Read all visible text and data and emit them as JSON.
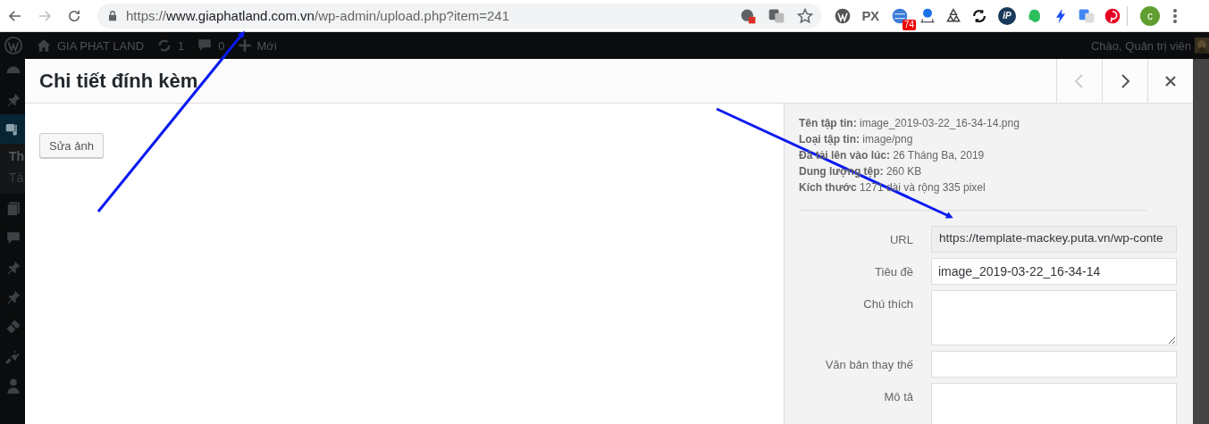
{
  "browser": {
    "back": {
      "disabled": false
    },
    "forward": {
      "disabled": true
    },
    "url": {
      "scheme": "https://",
      "host": "www.giaphatland.com.vn",
      "path": "/wp-admin/upload.php?item=241"
    },
    "omnibox_icons": [
      {
        "kind": "cookie-blocked"
      },
      {
        "kind": "translate"
      },
      {
        "kind": "star"
      }
    ],
    "extensions": [
      {
        "kind": "wordpress"
      },
      {
        "kind": "text",
        "label": "PX"
      },
      {
        "kind": "globe",
        "badge": "74"
      },
      {
        "kind": "scale"
      },
      {
        "kind": "recycle"
      },
      {
        "kind": "sync"
      },
      {
        "kind": "circle-text",
        "label": "iP"
      },
      {
        "kind": "elephant"
      },
      {
        "kind": "bolt"
      },
      {
        "kind": "translate"
      },
      {
        "kind": "pinterest"
      }
    ],
    "profile": {
      "initial": "c"
    }
  },
  "admin_bar": {
    "site": "GIA PHAT LAND",
    "updates": "1",
    "comments": "0",
    "new": "Mới",
    "greeting": "Chào, Quản trị viên"
  },
  "sidebar": {
    "items": [
      {
        "kind": "dashboard",
        "selected": false
      },
      {
        "kind": "pin",
        "selected": false
      },
      {
        "kind": "media",
        "selected": true,
        "children": [
          {
            "label": "Th",
            "selected": true
          },
          {
            "label": "Tà",
            "selected": false
          }
        ]
      },
      {
        "kind": "pages",
        "selected": false
      },
      {
        "kind": "comment",
        "selected": false
      },
      {
        "kind": "pin",
        "selected": false
      },
      {
        "kind": "pin",
        "selected": false
      },
      {
        "kind": "brush",
        "selected": false
      },
      {
        "kind": "plug",
        "selected": false
      },
      {
        "kind": "user",
        "selected": false
      }
    ]
  },
  "modal": {
    "title": "Chi tiết đính kèm",
    "prev": {
      "disabled": true
    },
    "next": {
      "disabled": false
    },
    "edit_button": "Sửa ảnh",
    "details": [
      "**Tên tập tin:** image_2019-03-22_16-34-14.png",
      "**Loại tập tin:** image/png",
      "**Đã tải lên vào lúc:** 26 Tháng Ba, 2019",
      "**Dung lượng tệp:** 260 KB",
      "**Kích thước** 1271 dài và rộng 335 pixel"
    ],
    "fields": [
      {
        "label": "URL",
        "kind": "readonly",
        "value": "https://template-mackey.puta.vn/wp-conte"
      },
      {
        "label": "Tiêu đề",
        "kind": "text",
        "value": "image_2019-03-22_16-34-14"
      },
      {
        "label": "Chú thích",
        "kind": "textarea"
      },
      {
        "label": "Văn bản thay thế",
        "kind": "text"
      },
      {
        "label": "Mô tả",
        "kind": "textarea"
      }
    ]
  }
}
